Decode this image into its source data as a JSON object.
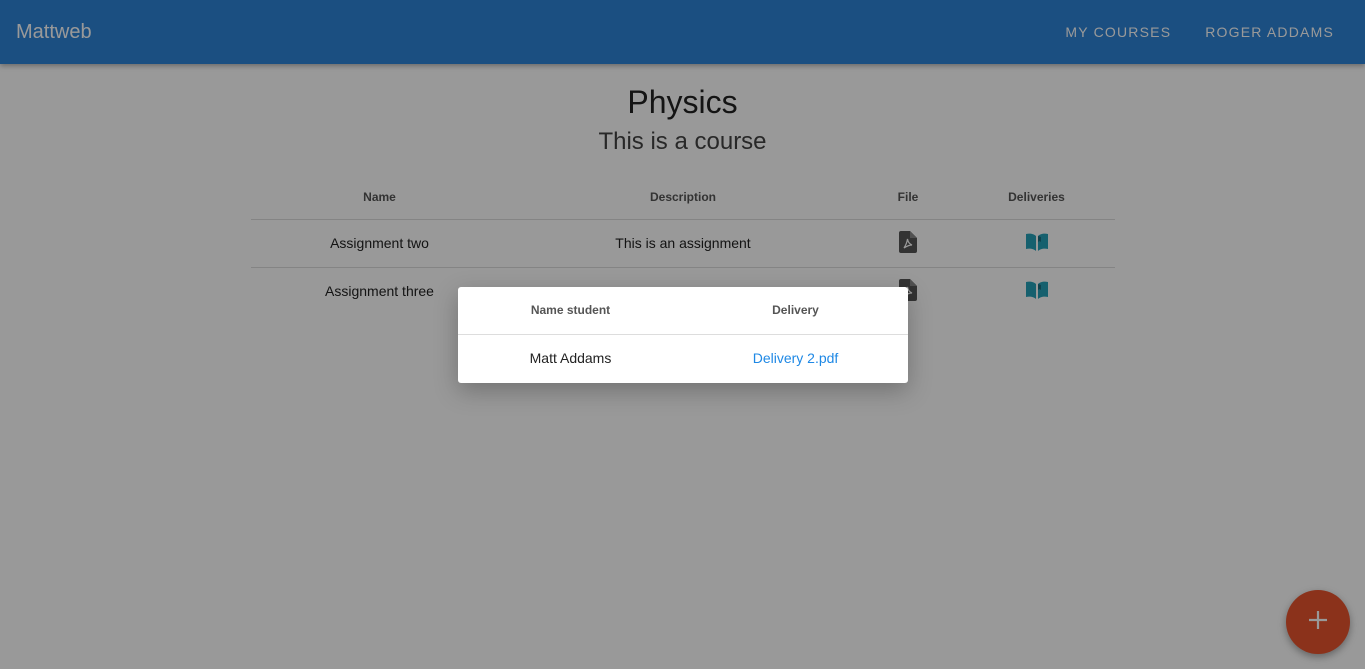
{
  "navbar": {
    "brand": "Mattweb",
    "links": [
      "MY COURSES",
      "ROGER ADDAMS"
    ]
  },
  "course": {
    "title": "Physics",
    "subtitle": "This is a course"
  },
  "table": {
    "headers": [
      "Name",
      "Description",
      "File",
      "Deliveries"
    ],
    "rows": [
      {
        "name": "Assignment two",
        "description": "This is an assignment",
        "file_icon": "pdf-file-icon",
        "deliveries_icon": "book-open-icon"
      },
      {
        "name": "Assignment three",
        "description": "",
        "file_icon": "pdf-file-icon",
        "deliveries_icon": "book-open-icon"
      }
    ]
  },
  "modal": {
    "headers": [
      "Name student",
      "Delivery"
    ],
    "rows": [
      {
        "student": "Matt Addams",
        "delivery": "Delivery 2.pdf"
      }
    ]
  },
  "fab": {
    "icon": "plus-icon"
  },
  "colors": {
    "navbar": "#2e84d8",
    "fab": "#e8542e",
    "link": "#1e88e5",
    "deliveries_icon": "#26a0b8"
  }
}
